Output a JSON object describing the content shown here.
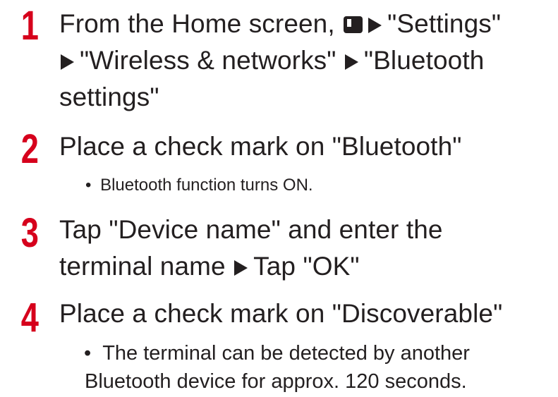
{
  "steps": [
    {
      "number": "1",
      "line1_a": "From the Home screen,",
      "line1_b": "\"Settings\"",
      "line2_a": "\"Wireless & networks\"",
      "line2_b": "\"Bluetooth",
      "line3": "settings\""
    },
    {
      "number": "2",
      "line1": "Place a check mark on \"Bluetooth\"",
      "bullet": "Bluetooth function turns ON."
    },
    {
      "number": "3",
      "line1": "Tap \"Device name\" and enter the",
      "line2_a": "terminal name",
      "line2_b": "Tap \"OK\""
    },
    {
      "number": "4",
      "line1": "Place a check mark on \"Discoverable\"",
      "bullet_line1": "The terminal can be detected by another",
      "bullet_line2": "Bluetooth device for approx. 120 seconds."
    }
  ],
  "bullet_symbol": "•",
  "icons": {
    "menu_key": "menu-key-icon",
    "arrow": "right-triangle-arrow-icon"
  },
  "colors": {
    "step_number": "#d6001c",
    "text": "#231f20",
    "background": "#ffffff"
  }
}
